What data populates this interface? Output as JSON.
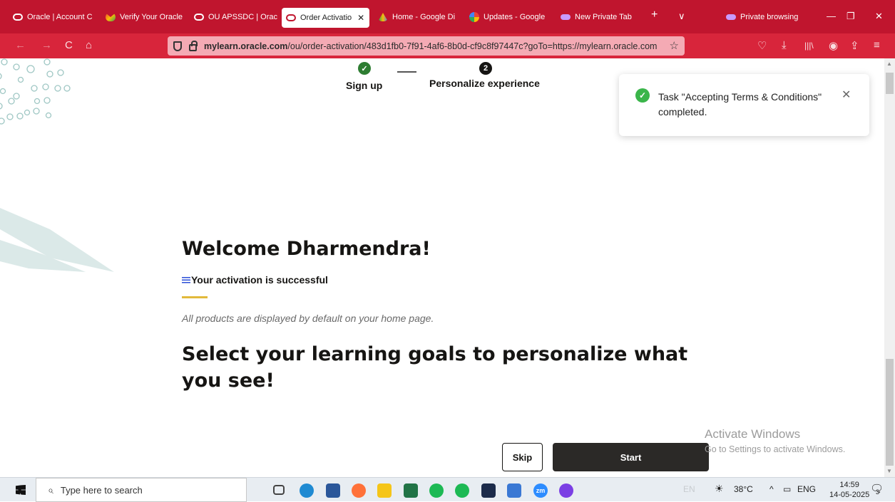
{
  "browser": {
    "tabs": [
      {
        "label": "Oracle | Account C",
        "icon": "oracle-icon",
        "active": false
      },
      {
        "label": "Verify Your Oracle",
        "icon": "gmail-icon",
        "active": false
      },
      {
        "label": "OU APSSDC | Orac",
        "icon": "oracle-icon",
        "active": false
      },
      {
        "label": "Order Activatio",
        "icon": "oracle-icon",
        "active": true
      },
      {
        "label": "Home - Google Di",
        "icon": "google-drive-icon",
        "active": false
      },
      {
        "label": "Updates - Google",
        "icon": "google-photos-icon",
        "active": false
      },
      {
        "label": "New Private Tab",
        "icon": "private-mask-icon",
        "active": false
      }
    ],
    "new_tab_symbol": "+",
    "tab_list_symbol": "∨",
    "private_label": "Private browsing",
    "address_host": "mylearn.oracle.com",
    "address_rest": "/ou/order-activation/483d1fb0-7f91-4af6-8b0d-cf9c8f97447c?goTo=https://mylearn.oracle.com",
    "nav": {
      "back": "←",
      "forward": "→",
      "reload": "C",
      "home": "⌂",
      "star": "☆"
    },
    "toolbar": {
      "pocket": "♡",
      "download": "⤓",
      "library": "|||\\",
      "account": "◉",
      "extensions": "⇪",
      "menu": "≡"
    },
    "window": {
      "minimize": "—",
      "restore": "❐",
      "close": "✕"
    }
  },
  "steps": [
    {
      "label": "Sign up",
      "mark": "✓",
      "done": true
    },
    {
      "label": "Personalize experience",
      "mark": "2",
      "done": false
    }
  ],
  "toast": {
    "check": "✓",
    "message": "Task \"Accepting Terms & Conditions\" completed.",
    "close": "✕"
  },
  "main": {
    "welcome": "Welcome Dharmendra!",
    "activation": "Your activation is successful",
    "note": "All products are displayed by default on your home page.",
    "goals_heading": "Select your learning goals to personalize what you see!",
    "skip_label": "Skip",
    "start_label": "Start"
  },
  "watermark": {
    "title": "Activate Windows",
    "subtitle": "Go to Settings to activate Windows."
  },
  "taskbar": {
    "search_placeholder": "Type here to search",
    "search_icon": "⌕",
    "apps": [
      {
        "name": "task-view-icon",
        "color": "#444444"
      },
      {
        "name": "edge-icon",
        "color": "#1f8ad2"
      },
      {
        "name": "word-icon",
        "color": "#2b579a"
      },
      {
        "name": "firefox-icon",
        "color": "#ff7139"
      },
      {
        "name": "file-explorer-icon",
        "color": "#f5c518"
      },
      {
        "name": "excel-icon",
        "color": "#217346"
      },
      {
        "name": "spotify-icon",
        "color": "#1db954"
      },
      {
        "name": "spotify-icon-2",
        "color": "#1db954"
      },
      {
        "name": "meta-icon",
        "color": "#1c2b4a"
      },
      {
        "name": "photos-icon",
        "color": "#3a78d4"
      },
      {
        "name": "zoom-icon",
        "color": "#2d8cff"
      },
      {
        "name": "firefox-private-icon",
        "color": "#7b3fe4"
      }
    ],
    "zm_label": "zm",
    "lang_hint": "EN",
    "temperature": "38°C",
    "caret": "^",
    "language": "ENG",
    "time": "14:59",
    "date": "14-05-2025",
    "notifications_count": "3"
  }
}
